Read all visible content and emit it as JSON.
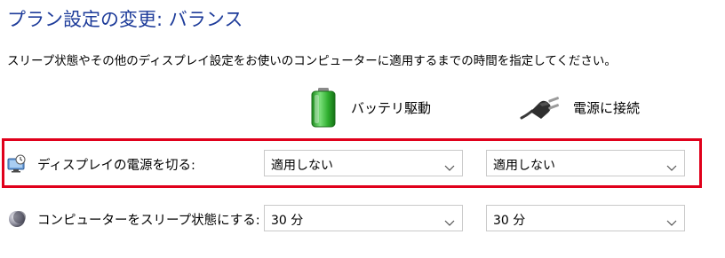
{
  "page": {
    "title": "プラン設定の変更: バランス",
    "description": "スリープ状態やその他のディスプレイ設定をお使いのコンピューターに適用するまでの時間を指定してください。"
  },
  "columns": {
    "battery": {
      "label": "バッテリ駆動",
      "icon": "battery-icon"
    },
    "plugged": {
      "label": "電源に接続",
      "icon": "power-plug-icon"
    }
  },
  "settings": [
    {
      "label": "ディスプレイの電源を切る:",
      "icon": "monitor-clock-icon",
      "battery_value": "適用しない",
      "plugged_value": "適用しない"
    },
    {
      "label": "コンピューターをスリープ状態にする:",
      "icon": "moon-icon",
      "battery_value": "30 分",
      "plugged_value": "30 分"
    }
  ],
  "colors": {
    "title": "#1e3c9a",
    "highlight": "#e0001b",
    "battery_green": "#3cb43c"
  }
}
